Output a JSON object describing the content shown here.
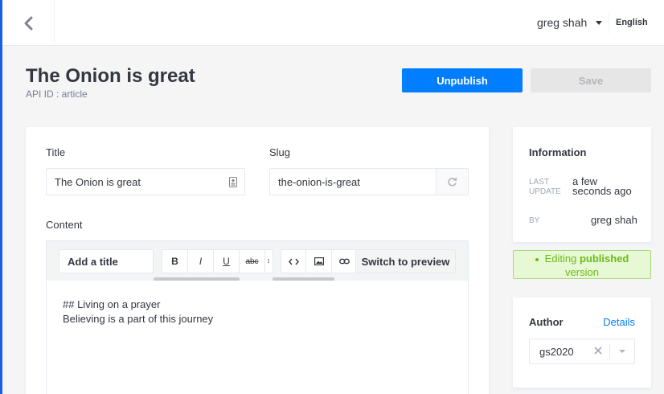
{
  "topbar": {
    "user_name": "greg shah",
    "language": "English"
  },
  "header": {
    "title": "The Onion is great",
    "api_id": "API ID : article",
    "unpublish_label": "Unpublish",
    "save_label": "Save"
  },
  "form": {
    "title_label": "Title",
    "title_value": "The Onion is great",
    "slug_label": "Slug",
    "slug_value": "the-onion-is-great",
    "content_label": "Content"
  },
  "editor": {
    "add_title_label": "Add a title",
    "bold_label": "B",
    "italic_label": "I",
    "underline_label": "U",
    "strike_label": "abc",
    "switch_preview_label": "Switch to preview",
    "lines": [
      "## Living on a prayer",
      "Believing is a part of this journey"
    ]
  },
  "information": {
    "title": "Information",
    "last_update_key_1": "LAST",
    "last_update_key_2": "UPDATE",
    "last_update_value_1": "a few",
    "last_update_value_2": "seconds ago",
    "by_key": "BY",
    "by_value": "greg shah"
  },
  "status": {
    "prefix": "Editing ",
    "highlight": "published",
    "suffix": "version"
  },
  "author": {
    "label": "Author",
    "details_link": "Details",
    "selected_value": "gs2020"
  },
  "colors": {
    "primary": "#007eff",
    "status_green": "#6dbb1a",
    "status_bg": "#e6f8d4"
  }
}
